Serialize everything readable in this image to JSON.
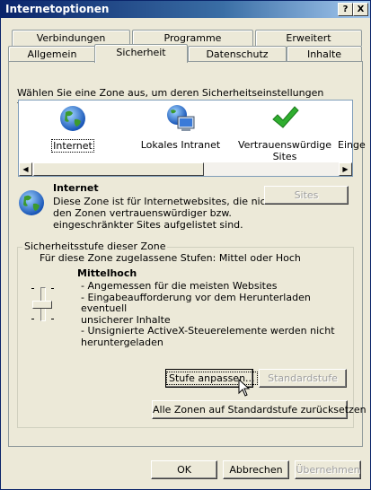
{
  "window": {
    "title": "Internetoptionen",
    "help_glyph": "?",
    "close_glyph": "X"
  },
  "tabs": {
    "row_back": [
      "Verbindungen",
      "Programme",
      "Erweitert"
    ],
    "row_front": [
      "Allgemein",
      "Sicherheit",
      "Datenschutz",
      "Inhalte"
    ],
    "active": "Sicherheit"
  },
  "security": {
    "instruction": "Wählen Sie eine Zone aus, um deren Sicherheitseinstellungen festzulegen.",
    "zones": [
      {
        "label": "Internet",
        "icon": "globe-icon",
        "selected": true
      },
      {
        "label": "Lokales Intranet",
        "icon": "computer-globe-icon"
      },
      {
        "label_line1": "Vertrauenswürdige",
        "label_line2": "Sites",
        "icon": "checkmark-icon"
      },
      {
        "label": "Einge",
        "icon": "restricted-icon"
      }
    ],
    "zone_info": {
      "name": "Internet",
      "desc_line1": "Diese Zone ist für Internetwebsites, die nicht in",
      "desc_line2": "den Zonen vertrauenswürdiger bzw.",
      "desc_line3": "eingeschränkter Sites aufgelistet sind.",
      "sites_button": "Sites"
    },
    "level_group": {
      "legend": "Sicherheitsstufe dieser Zone",
      "allowed": "Für diese Zone zugelassene Stufen: Mittel oder Hoch",
      "level_name": "Mittelhoch",
      "bullets": [
        "- Angemessen für die meisten Websites",
        "- Eingabeaufforderung vor dem Herunterladen eventuell",
        "unsicherer Inhalte",
        "- Unsignierte ActiveX-Steuerelemente werden nicht",
        "heruntergeladen"
      ],
      "custom_button": "Stufe anpassen...",
      "default_button": "Standardstufe"
    },
    "reset_all_button": "Alle Zonen auf Standardstufe zurücksetzen"
  },
  "footer": {
    "ok": "OK",
    "cancel": "Abbrechen",
    "apply": "Übernehmen"
  },
  "colors": {
    "titlebar_start": "#0a246a",
    "dialog_bg": "#ece9d8",
    "check_green": "#2fae2f"
  }
}
